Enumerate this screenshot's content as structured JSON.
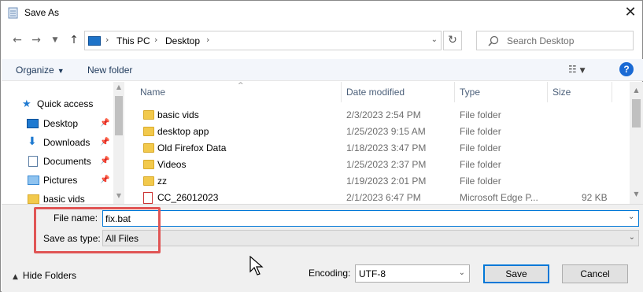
{
  "window": {
    "title": "Save As"
  },
  "address": {
    "crumbs": [
      "This PC",
      "Desktop"
    ]
  },
  "search": {
    "placeholder": "Search Desktop"
  },
  "toolbar": {
    "organize": "Organize",
    "new_folder": "New folder",
    "help": "?"
  },
  "sidebar": {
    "items": [
      {
        "label": "Quick access",
        "icon": "star-icon",
        "color": "#1f7ad1"
      },
      {
        "label": "Desktop",
        "icon": "desktop-icon",
        "color": "#1f7ad1",
        "pinned": true
      },
      {
        "label": "Downloads",
        "icon": "download-icon",
        "color": "#1f7ad1",
        "pinned": true
      },
      {
        "label": "Documents",
        "icon": "document-icon",
        "color": "#5d7fa6",
        "pinned": true
      },
      {
        "label": "Pictures",
        "icon": "picture-icon",
        "color": "#3a8ad4",
        "pinned": true
      },
      {
        "label": "basic vids",
        "icon": "folder-icon",
        "color": "#f2c94c"
      }
    ]
  },
  "columns": {
    "name": "Name",
    "date": "Date modified",
    "type": "Type",
    "size": "Size"
  },
  "files": [
    {
      "name": "basic vids",
      "date": "2/3/2023 2:54 PM",
      "type": "File folder",
      "size": "",
      "icon": "folder-icon"
    },
    {
      "name": "desktop app",
      "date": "1/25/2023 9:15 AM",
      "type": "File folder",
      "size": "",
      "icon": "folder-icon"
    },
    {
      "name": "Old Firefox Data",
      "date": "1/18/2023 3:47 PM",
      "type": "File folder",
      "size": "",
      "icon": "folder-icon"
    },
    {
      "name": "Videos",
      "date": "1/25/2023 2:37 PM",
      "type": "File folder",
      "size": "",
      "icon": "folder-icon"
    },
    {
      "name": "zz",
      "date": "1/19/2023 2:01 PM",
      "type": "File folder",
      "size": "",
      "icon": "folder-icon"
    },
    {
      "name": "CC_26012023",
      "date": "2/1/2023 6:47 PM",
      "type": "Microsoft Edge P...",
      "size": "92 KB",
      "icon": "pdf-icon"
    }
  ],
  "form": {
    "filename_label": "File name:",
    "filename_value": "fix.bat",
    "savetype_label": "Save as type:",
    "savetype_value": "All Files",
    "encoding_label": "Encoding:",
    "encoding_value": "UTF-8",
    "save": "Save",
    "cancel": "Cancel",
    "hide_folders": "Hide Folders"
  },
  "colors": {
    "accent": "#0078d7",
    "highlight": "#e05555"
  }
}
